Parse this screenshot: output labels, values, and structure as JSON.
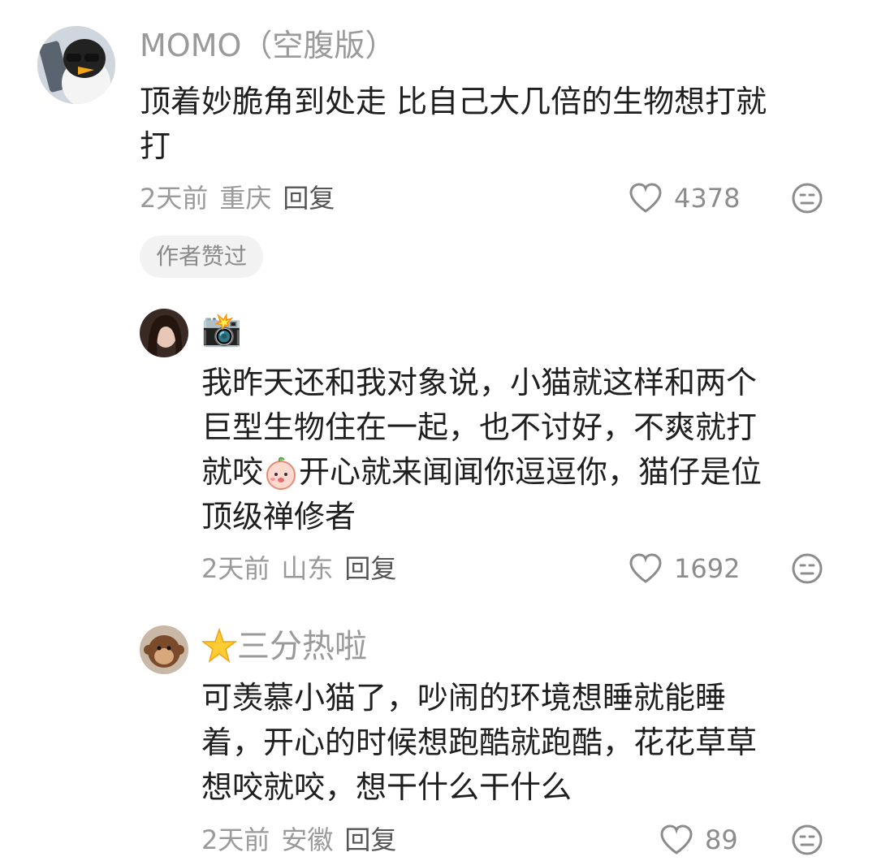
{
  "comments": [
    {
      "username": "MOMO（空腹版）",
      "text_lines": [
        "顶着妙脆角到处走 比自己大几倍的生物想打就",
        "打"
      ],
      "time": "2天前",
      "location": "重庆",
      "reply_label": "回复",
      "likes": "4378",
      "badge": "作者赞过"
    },
    {
      "username": "📸",
      "text_lines": [
        "我昨天还和我对象说，小猫就这样和两个",
        "巨型生物住在一起，也不讨好，不爽就打",
        "就咬",
        "开心就来闻闻你逗逗你，猫仔是位",
        "顶级禅修者"
      ],
      "time": "2天前",
      "location": "山东",
      "reply_label": "回复",
      "likes": "1692"
    },
    {
      "username_emoji": "🌟",
      "username": "三分热啦",
      "text_lines": [
        "可羡慕小猫了，吵闹的环境想睡就能睡",
        "着，开心的时候想跑酷就跑酷，花花草草",
        "想咬就咬，想干什么干什么"
      ],
      "time": "2天前",
      "location": "安徽",
      "reply_label": "回复",
      "likes": "89"
    }
  ],
  "icons": {
    "like": "heart-outline-icon",
    "more": "face-neutral-icon"
  },
  "colors": {
    "meta": "#9a9a9a",
    "text": "#1f1f1f",
    "badge_bg": "#f2f2f2"
  }
}
